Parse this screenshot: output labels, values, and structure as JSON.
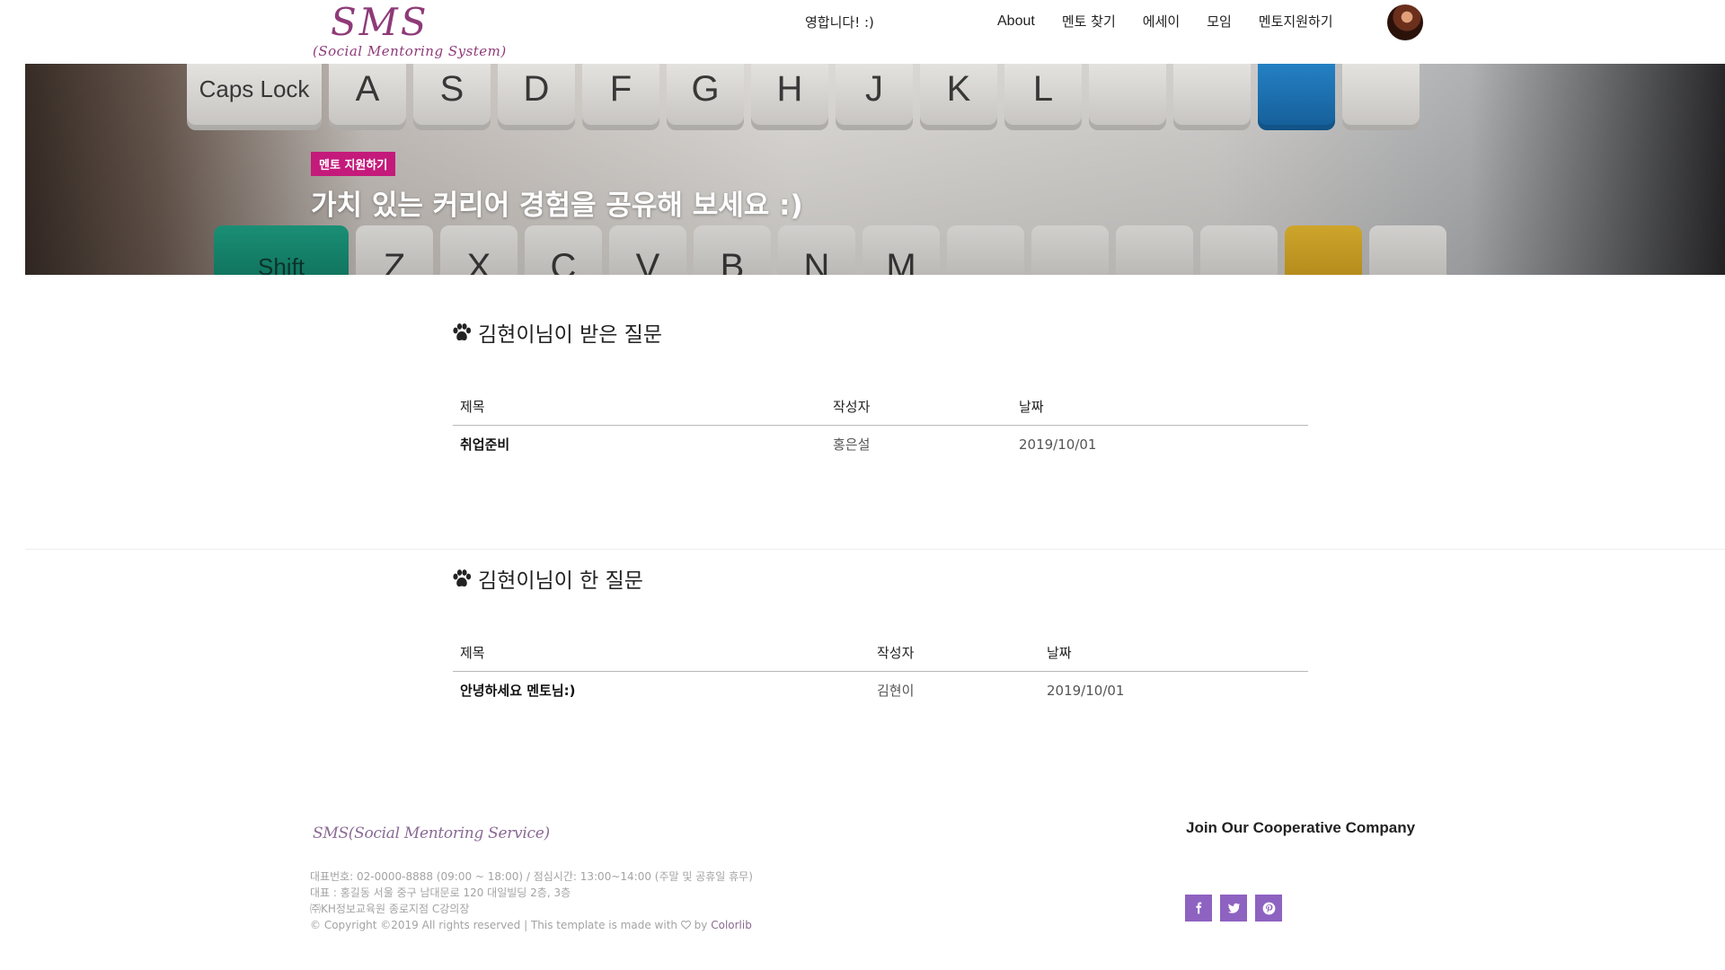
{
  "header": {
    "logo_title": "SMS",
    "logo_subtitle": "(Social Mentoring System)",
    "welcome": "영합니다! :)",
    "nav": [
      "About",
      "멘토 찾기",
      "에세이",
      "모임",
      "멘토지원하기"
    ]
  },
  "hero": {
    "badge": "멘토 지원하기",
    "title": "가치 있는 커리어 경험을 공유해 보세요 :)",
    "keys_top": [
      "Caps Lock",
      "A",
      "S",
      "D",
      "F",
      "G",
      "H",
      "J",
      "K",
      "L",
      "",
      "",
      "",
      ""
    ],
    "keys_bottom": [
      "Shift",
      "Z",
      "X",
      "C",
      "V",
      "B",
      "N",
      "M",
      "",
      "",
      "",
      "",
      "",
      ""
    ]
  },
  "received": {
    "title": "김현이님이 받은 질문",
    "columns": [
      "제목",
      "작성자",
      "날짜"
    ],
    "rows": [
      {
        "title": "취업준비",
        "author": "홍은설",
        "date": "2019/10/01"
      }
    ]
  },
  "asked": {
    "title": "김현이님이 한 질문",
    "columns": [
      "제목",
      "작성자",
      "날짜"
    ],
    "rows": [
      {
        "title": "안녕하세요 멘토님:)",
        "author": "김현이",
        "date": "2019/10/01"
      }
    ]
  },
  "footer": {
    "logo": "SMS(Social Mentoring Service)",
    "line1": "대표번호: 02-0000-8888 (09:00 ~ 18:00) / 점심시간: 13:00~14:00 (주말 및 공휴일 휴무)",
    "line2": "대표 : 홍길동 서울 중구 남대문로 120 대일빌딩 2층, 3층",
    "line3": "㈜KH정보교육원 종로지점 C강의장",
    "copyright": "© Copyright ©2019 All rights reserved | This template is made with",
    "by": "by",
    "credit": "Colorlib",
    "join_title": "Join Our Cooperative Company",
    "social": [
      "facebook-icon",
      "twitter-icon",
      "pinterest-icon"
    ]
  },
  "colors": {
    "brand": "#8e3a78",
    "badge": "#c41a7b",
    "social": "#8e62c1"
  }
}
